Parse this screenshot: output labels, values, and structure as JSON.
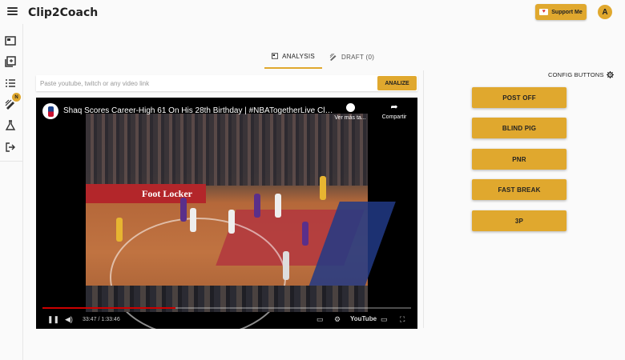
{
  "app": {
    "title": "Clip2Coach"
  },
  "header": {
    "support_label": "Support Me",
    "avatar_initial": "A"
  },
  "sidebar": {
    "items": [
      {
        "name": "video-library-icon"
      },
      {
        "name": "collections-icon"
      },
      {
        "name": "list-icon"
      },
      {
        "name": "draw-plays-icon",
        "badge": "N"
      },
      {
        "name": "lab-flask-icon"
      },
      {
        "name": "logout-icon"
      }
    ]
  },
  "tabs": [
    {
      "label": "ANALYSIS",
      "active": true,
      "icon": "video-icon"
    },
    {
      "label": "DRAFT (0)",
      "active": false,
      "icon": "draw-icon"
    }
  ],
  "url_bar": {
    "placeholder": "Paste youtube, twitch or any video link",
    "value": "",
    "analize_label": "ANALIZE"
  },
  "video": {
    "title": "Shaq Scores Career-High 61 On His 28th Birthday | #NBATogetherLive Cla...",
    "watch_later_label": "Ver más ta...",
    "share_label": "Compartir",
    "time": "33:47 / 1:33:46",
    "progress": 0.36,
    "brand": "YouTube",
    "adboard": "Foot Locker"
  },
  "config": {
    "label": "CONFIG BUTTONS",
    "buttons": [
      "POST OFF",
      "BLIND PIG",
      "PNR",
      "FAST BREAK",
      "3P"
    ]
  },
  "colors": {
    "accent": "#e0a82e",
    "background": "#fafafa"
  }
}
